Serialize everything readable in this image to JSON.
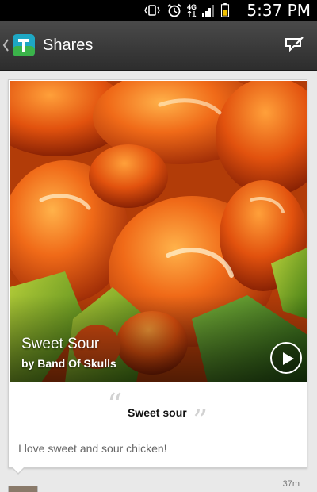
{
  "status_bar": {
    "time": "5:37 PM",
    "network_type": "4G",
    "icons": [
      "vibrate-icon",
      "alarm-icon",
      "network-4g-icon",
      "signal-icon",
      "battery-icon"
    ]
  },
  "action_bar": {
    "title": "Shares",
    "icons": [
      "up-chevron-icon",
      "app-logo-icon",
      "compose-icon"
    ]
  },
  "share_card": {
    "track_title": "Sweet Sour",
    "track_artist": "by Band Of Skulls",
    "quote": "Sweet sour",
    "comment": "I love sweet and sour chicken!",
    "quote_open_glyph": "“",
    "quote_close_glyph": "”"
  },
  "next_item": {
    "time_ago": "37m"
  },
  "colors": {
    "status_bar_bg": "#000000",
    "action_bar_bg": "#3a3a3a",
    "page_bg": "#e9e9e9",
    "card_bg": "#ffffff",
    "app_icon_teal": "#1ea7c4",
    "app_icon_green": "#3bb34a"
  }
}
